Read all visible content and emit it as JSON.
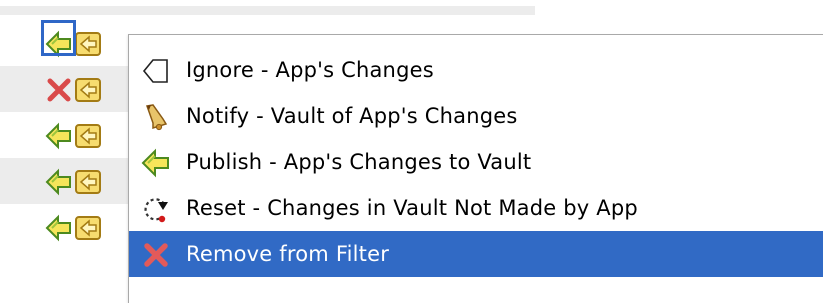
{
  "menu": {
    "items": [
      {
        "label": "Ignore - App's Changes",
        "icon": "ignore-icon"
      },
      {
        "label": "Notify - Vault of App's Changes",
        "icon": "bell-icon"
      },
      {
        "label": "Publish - App's Changes to Vault",
        "icon": "publish-arrow-icon"
      },
      {
        "label": "Reset - Changes in Vault Not Made by App",
        "icon": "reset-icon"
      },
      {
        "label": "Remove from Filter",
        "icon": "remove-x-icon"
      }
    ],
    "selected_index": 4
  },
  "colors": {
    "selection": "#316ac5",
    "focus_border": "#2f67c7",
    "row_alt": "#ececec"
  }
}
